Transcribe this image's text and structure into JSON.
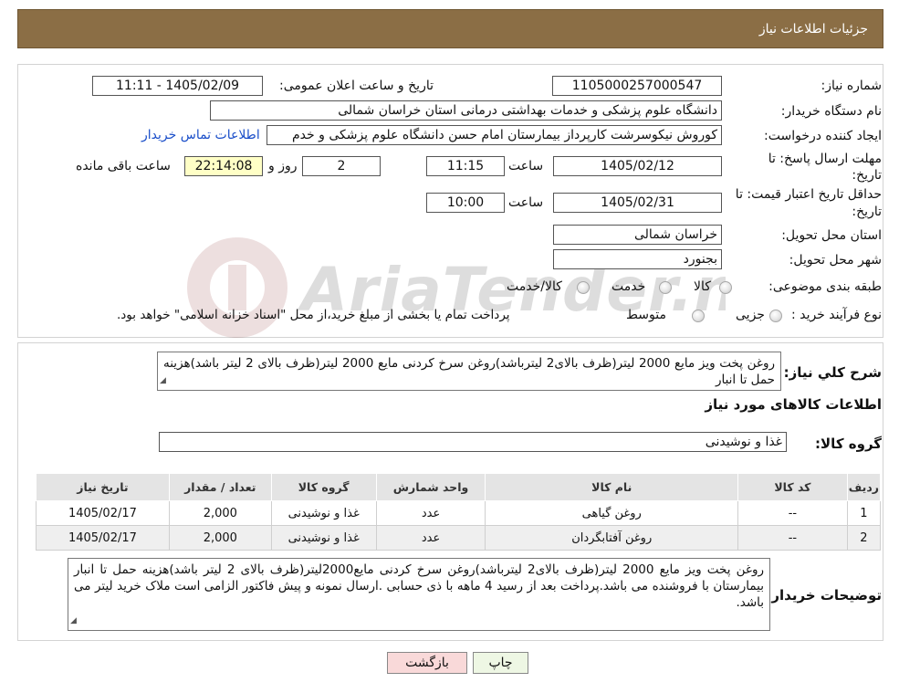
{
  "header": {
    "title": "جزئیات اطلاعات نیاز"
  },
  "watermark": {
    "text": "AriaTender.neT"
  },
  "info": {
    "need_number_label": "شماره نیاز:",
    "need_number": "1105000257000547",
    "announce_label": "تاریخ و ساعت اعلان عمومی:",
    "announce_value": "1405/02/09 - 11:11",
    "buyer_org_label": "نام دستگاه خریدار:",
    "buyer_org": "دانشگاه علوم پزشکی و خدمات بهداشتی درمانی استان خراسان شمالی",
    "requester_label": "ایجاد کننده درخواست:",
    "requester": "کوروش نیکوسرشت کارپرداز بیمارستان امام حسن دانشگاه علوم پزشکی و خدم",
    "contact_link": "اطلاعات تماس خریدار",
    "deadline_label_line1": "مهلت ارسال پاسخ: تا",
    "deadline_label_line2": "تاریخ:",
    "deadline_date": "1405/02/12",
    "time_label": "ساعت",
    "deadline_time": "11:15",
    "days_value": "2",
    "days_label": "روز و",
    "remaining_time": "22:14:08",
    "remaining_label": "ساعت باقی مانده",
    "validity_label_line1": "حداقل تاریخ اعتبار قیمت: تا",
    "validity_label_line2": "تاریخ:",
    "validity_date": "1405/02/31",
    "validity_time_label": "ساعت",
    "validity_time": "10:00",
    "province_label": "استان محل تحویل:",
    "province": "خراسان شمالی",
    "city_label": "شهر محل تحویل:",
    "city": "بجنورد",
    "category_label": "طبقه بندی موضوعی:",
    "category_options": [
      "کالا",
      "خدمت",
      "کالا/خدمت"
    ],
    "process_label": "نوع فرآیند خرید :",
    "process_options": [
      "جزیی",
      "متوسط"
    ],
    "process_note": "پرداخت تمام یا بخشی از مبلغ خرید،از محل \"اسناد خزانه اسلامی\" خواهد بود."
  },
  "summary": {
    "label": "شرح کلي نياز:",
    "text": "روغن پخت ویز مایع 2000 لیتر(ظرف بالای2 لیترباشد)روغن سرخ کردنی مایع 2000 لیتر(ظرف بالای 2 لیتر باشد)هزینه حمل تا انبار",
    "goods_info_title": "اطلاعات کالاهای مورد نیاز",
    "group_label": "گروه کالا:",
    "group_value": "غذا و نوشیدنی"
  },
  "table": {
    "headers": [
      "ردیف",
      "کد کالا",
      "نام کالا",
      "واحد شمارش",
      "گروه کالا",
      "تعداد / مقدار",
      "تاریخ نیاز"
    ],
    "rows": [
      [
        "1",
        "--",
        "روغن گیاهی",
        "عدد",
        "غذا و نوشیدنی",
        "2,000",
        "1405/02/17"
      ],
      [
        "2",
        "--",
        "روغن آفتابگردان",
        "عدد",
        "غذا و نوشیدنی",
        "2,000",
        "1405/02/17"
      ]
    ]
  },
  "buyer_notes": {
    "label": "توضیحات خریدار:",
    "text": "روغن پخت ویز مایع 2000 لیتر(ظرف بالای2 لیترباشد)روغن سرخ کردنی مایع2000لیتر(ظرف بالای 2 لیتر باشد)هزینه حمل تا انبار بیمارستان با فروشنده می باشد.پرداخت بعد از رسید 4 ماهه با ذی حسابی  .ارسال نمونه و پیش فاکتور الزامی است ملاک خرید لیتر می باشد."
  },
  "buttons": {
    "print": "چاپ",
    "back": "بازگشت"
  },
  "colors": {
    "header_bg": "#8b6e45",
    "link": "#1a4ec9",
    "back_btn_bg": "#f9d9d9",
    "print_btn_bg": "#eef7e4"
  }
}
